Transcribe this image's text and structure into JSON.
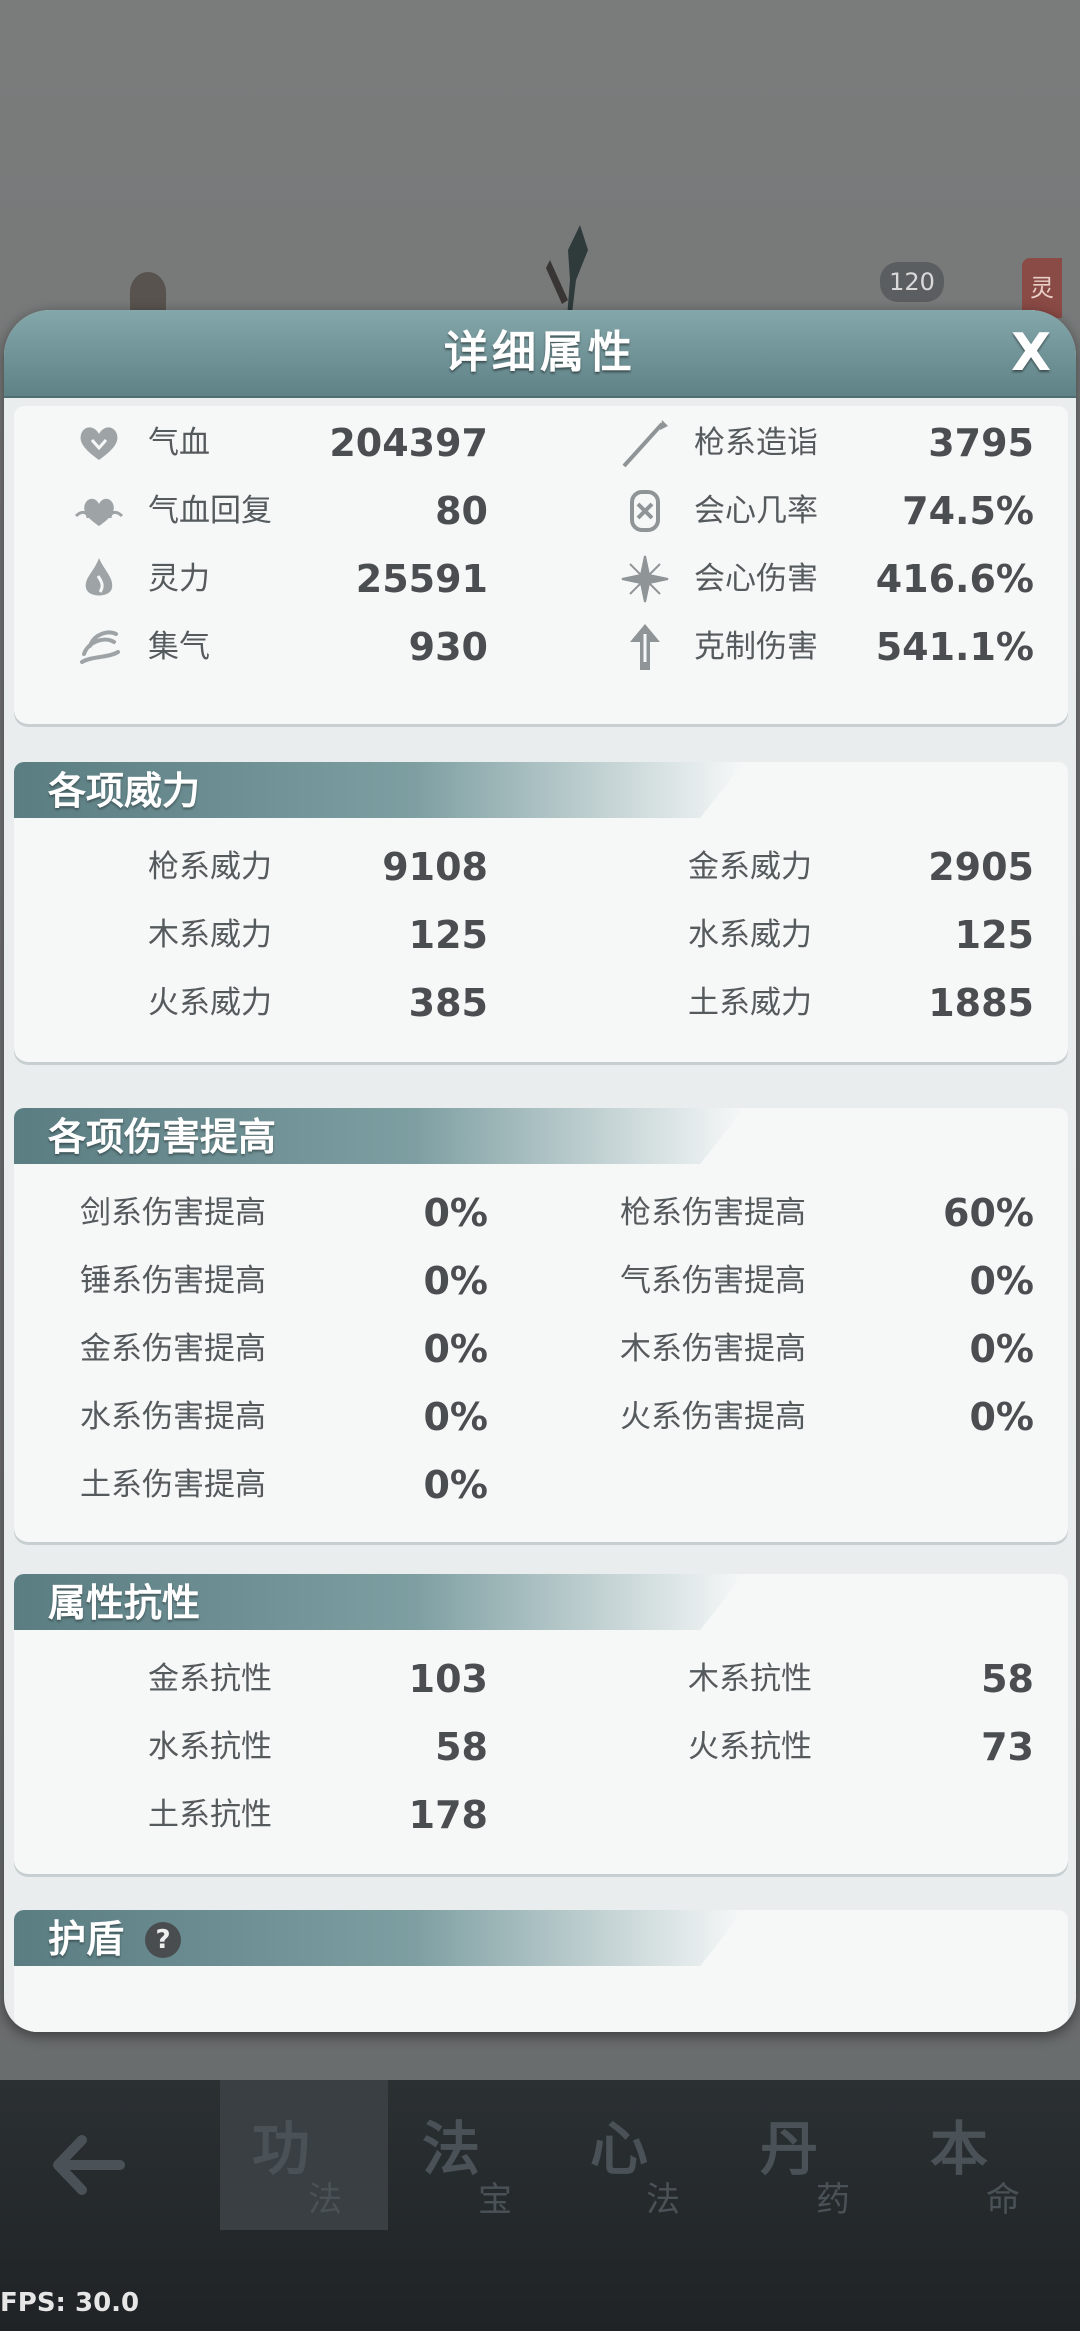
{
  "background": {
    "level_badge": "120",
    "tag": "灵"
  },
  "modal": {
    "title": "详细属性",
    "close_label": "X",
    "basic_stats": {
      "left": [
        {
          "icon": "heart-icon",
          "label": "气血",
          "value": "204397"
        },
        {
          "icon": "heart-regen-icon",
          "label": "气血回复",
          "value": "80"
        },
        {
          "icon": "flame-drop-icon",
          "label": "灵力",
          "value": "25591"
        },
        {
          "icon": "swirl-icon",
          "label": "集气",
          "value": "930"
        }
      ],
      "right": [
        {
          "icon": "spear-icon",
          "label": "枪系造诣",
          "value": "3795"
        },
        {
          "icon": "crit-rate-icon",
          "label": "会心几率",
          "value": "74.5%"
        },
        {
          "icon": "crit-damage-icon",
          "label": "会心伤害",
          "value": "416.6%"
        },
        {
          "icon": "counter-damage-icon",
          "label": "克制伤害",
          "value": "541.1%"
        }
      ]
    },
    "power": {
      "title": "各项威力",
      "left": [
        {
          "label": "枪系威力",
          "value": "9108"
        },
        {
          "label": "木系威力",
          "value": "125"
        },
        {
          "label": "火系威力",
          "value": "385"
        }
      ],
      "right": [
        {
          "label": "金系威力",
          "value": "2905"
        },
        {
          "label": "水系威力",
          "value": "125"
        },
        {
          "label": "土系威力",
          "value": "1885"
        }
      ]
    },
    "damage_boost": {
      "title": "各项伤害提高",
      "left": [
        {
          "label": "剑系伤害提高",
          "value": "0%"
        },
        {
          "label": "锤系伤害提高",
          "value": "0%"
        },
        {
          "label": "金系伤害提高",
          "value": "0%"
        },
        {
          "label": "水系伤害提高",
          "value": "0%"
        },
        {
          "label": "土系伤害提高",
          "value": "0%"
        }
      ],
      "right": [
        {
          "label": "枪系伤害提高",
          "value": "60%"
        },
        {
          "label": "气系伤害提高",
          "value": "0%"
        },
        {
          "label": "木系伤害提高",
          "value": "0%"
        },
        {
          "label": "火系伤害提高",
          "value": "0%"
        }
      ]
    },
    "resistance": {
      "title": "属性抗性",
      "left": [
        {
          "label": "金系抗性",
          "value": "103"
        },
        {
          "label": "水系抗性",
          "value": "58"
        },
        {
          "label": "土系抗性",
          "value": "178"
        }
      ],
      "right": [
        {
          "label": "木系抗性",
          "value": "58"
        },
        {
          "label": "火系抗性",
          "value": "73"
        }
      ]
    },
    "shield": {
      "title": "护盾",
      "help_label": "?"
    }
  },
  "bottom_nav": {
    "tabs": [
      {
        "main": "功",
        "sub": "法"
      },
      {
        "main": "法",
        "sub": "宝"
      },
      {
        "main": "心",
        "sub": "法"
      },
      {
        "main": "丹",
        "sub": "药"
      },
      {
        "main": "本",
        "sub": "命"
      }
    ],
    "active_index": 0
  },
  "fps": "FPS: 30.0",
  "colors": {
    "accent": "#5f8287",
    "panel": "#e9edee",
    "text": "#4a4e51",
    "nav_bg": "#23282b"
  }
}
